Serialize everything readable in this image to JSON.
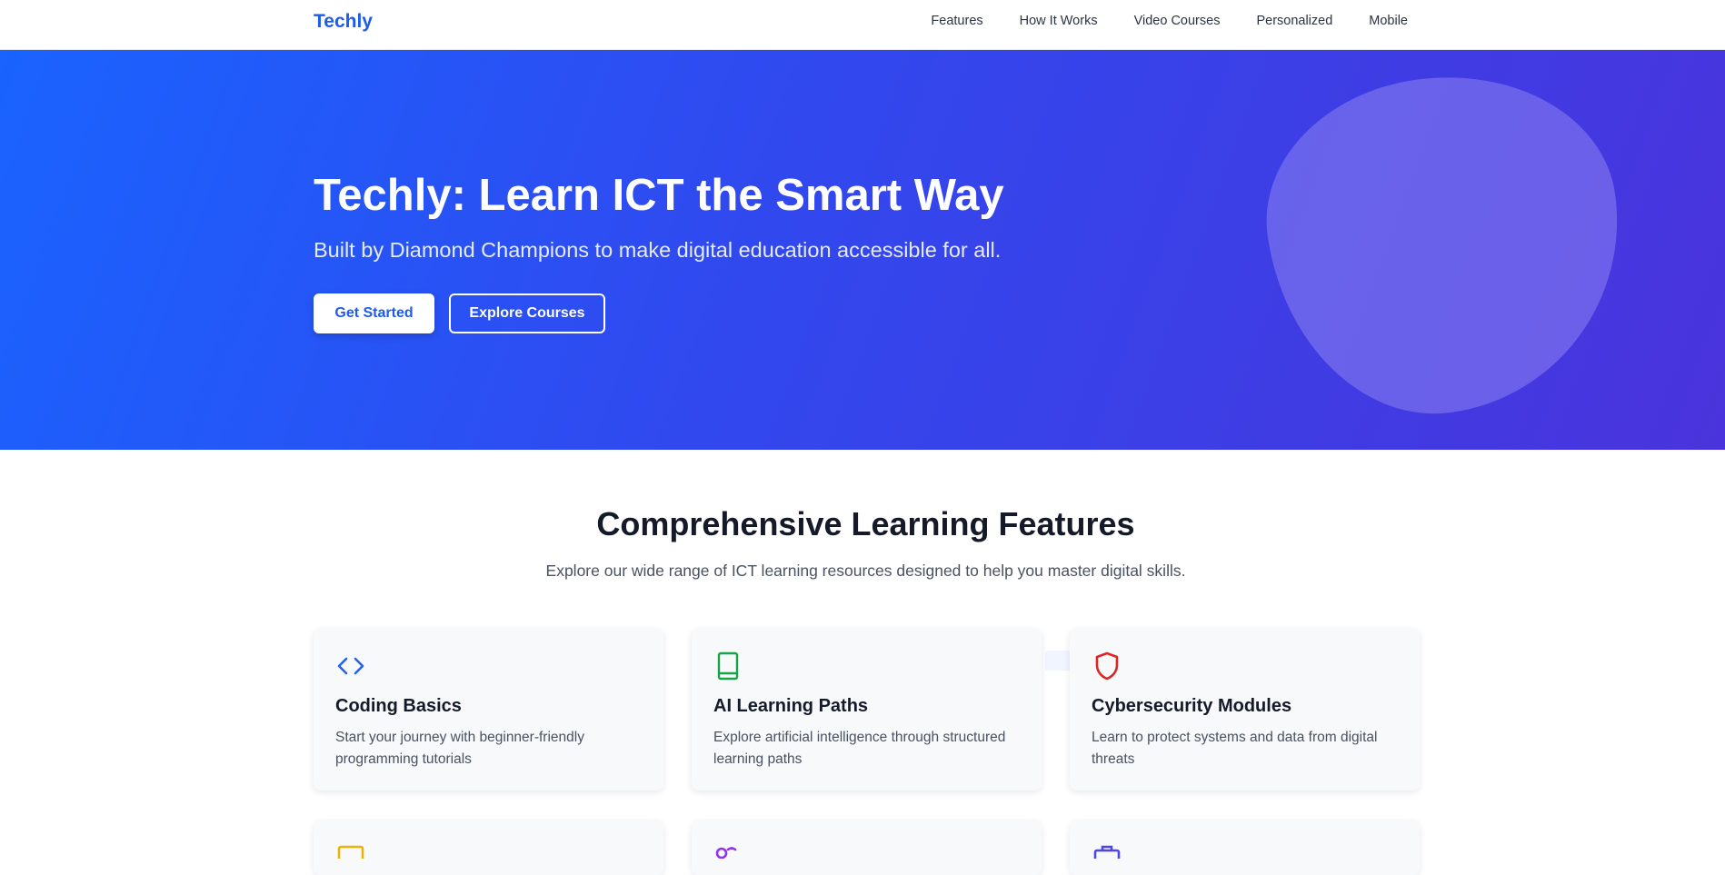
{
  "nav": {
    "brand": "Techly",
    "links": [
      "Features",
      "How It Works",
      "Video Courses",
      "Personalized",
      "Mobile"
    ]
  },
  "hero": {
    "title": "Techly: Learn ICT the Smart Way",
    "subtitle": "Built by Diamond Champions to make digital education accessible for all.",
    "primary_button": "Get Started",
    "secondary_button": "Explore Courses"
  },
  "features": {
    "title": "Comprehensive Learning Features",
    "subtitle": "Explore our wide range of ICT learning resources designed to help you master digital skills.",
    "cards": [
      {
        "icon": "code-icon",
        "color": "#2563eb",
        "title": "Coding Basics",
        "desc": "Start your journey with beginner-friendly programming tutorials"
      },
      {
        "icon": "book-icon",
        "color": "#16a34a",
        "title": "AI Learning Paths",
        "desc": "Explore artificial intelligence through structured learning paths"
      },
      {
        "icon": "shield-icon",
        "color": "#dc2626",
        "title": "Cybersecurity Modules",
        "desc": "Learn to protect systems and data from digital threats"
      }
    ],
    "partial_cards": [
      {
        "icon": "monitor-icon",
        "color": "#eab308"
      },
      {
        "icon": "network-icon",
        "color": "#9333ea"
      },
      {
        "icon": "briefcase-icon",
        "color": "#4f46e5"
      }
    ]
  },
  "colors": {
    "brand": "#1d5bf0",
    "hero_start": "#1a63ff",
    "hero_end": "#4a33dc"
  }
}
